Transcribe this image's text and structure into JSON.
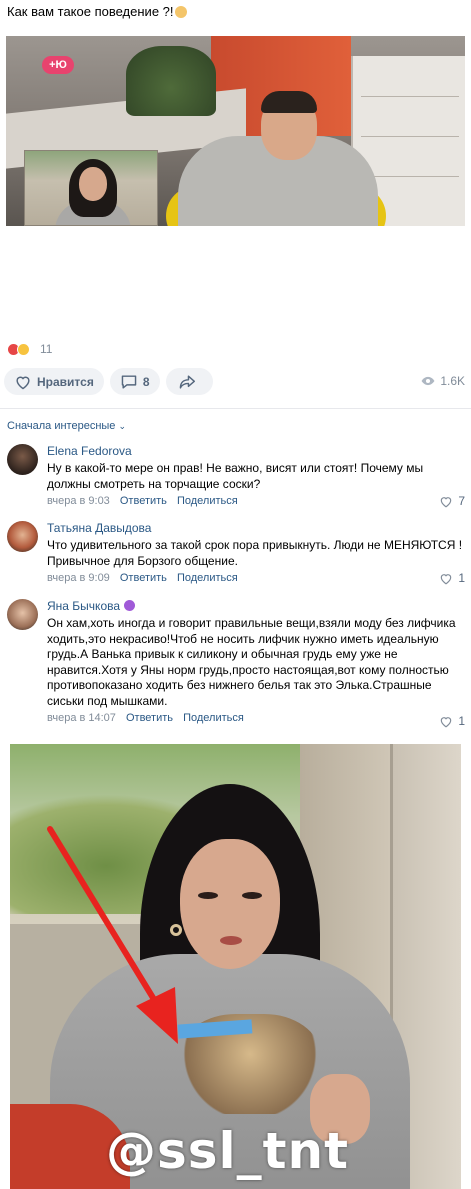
{
  "post": {
    "text": "Как вам такое поведение ?!",
    "emoji": "woman-facepalming-emoji"
  },
  "video": {
    "channel_logo": "+Ю"
  },
  "reactions": {
    "icons": [
      "heart-reaction",
      "laugh-reaction"
    ],
    "count": "11"
  },
  "actions": {
    "like_label": "Нравится",
    "comments_count": "8",
    "views": "1.6K"
  },
  "comments_sort": "Сначала интересные",
  "comments": [
    {
      "author": "Elena Fedorova",
      "text": "Ну в какой-то мере он прав! Не важно, висят или стоят! Почему мы должны смотреть на торчащие соски?",
      "time": "вчера в 9:03",
      "reply": "Ответить",
      "share": "Поделиться",
      "likes": "7"
    },
    {
      "author": "Татьяна Давыдова",
      "text": "Что удивительного за такой срок пора привыкнуть. Люди не МЕНЯЮТСЯ ! Привычное для Борзого общение.",
      "time": "вчера в 9:09",
      "reply": "Ответить",
      "share": "Поделиться",
      "likes": "1"
    },
    {
      "author": "Яна Бычкова",
      "badge": "paw-icon",
      "text": "Он хам,хоть иногда и говорит правильные вещи,взяли моду без лифчика ходить,это некрасиво!Чтоб не носить лифчик нужно иметь идеальную грудь.А Ванька привык к силикону и обычная грудь ему уже не нравится.Хотя у Яны норм грудь,просто настоящая,вот кому полностью противопоказано ходить без нижнего белья так это Элька.Страшные сиськи под мышками.",
      "time": "вчера в 14:07",
      "reply": "Ответить",
      "share": "Поделиться",
      "likes": "1"
    }
  ],
  "photo": {
    "watermark": "@ssl_tnt",
    "arrow_color": "#e8231f"
  },
  "colors": {
    "link": "#2a5885",
    "muted": "#818c99",
    "button_bg": "#f0f2f5"
  }
}
